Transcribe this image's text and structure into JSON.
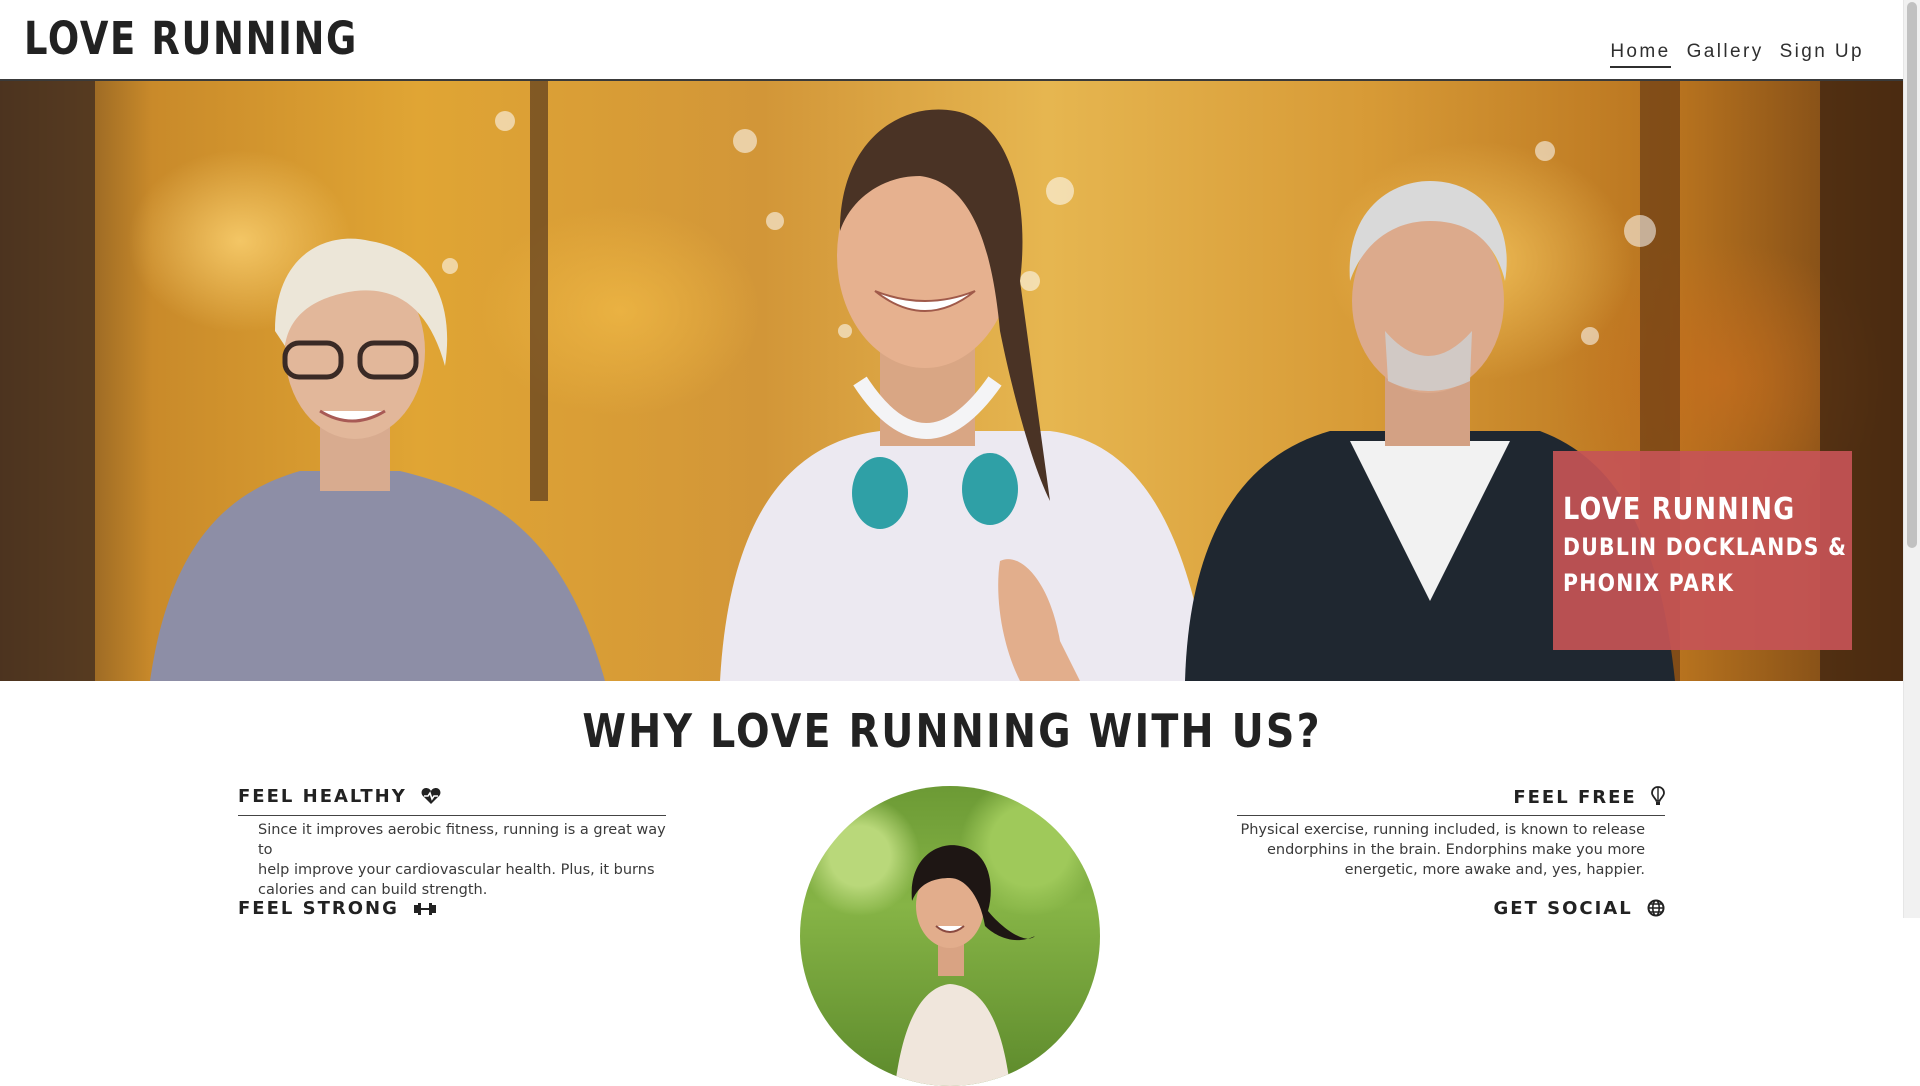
{
  "header": {
    "logo": "LOVE RUNNING",
    "nav": [
      {
        "label": "Home",
        "active": true
      },
      {
        "label": "Gallery",
        "active": false
      },
      {
        "label": "Sign Up",
        "active": false
      }
    ]
  },
  "hero": {
    "card_title": "LOVE RUNNING",
    "card_line1": "DUBLIN DOCKLANDS &",
    "card_line2": "PHONIX PARK",
    "card_color": "#c65456"
  },
  "main": {
    "title": "WHY LOVE RUNNING WITH US?",
    "features": [
      {
        "heading": "FEEL HEALTHY",
        "icon": "heartbeat-icon",
        "lines": [
          "Since it improves aerobic fitness, running is a great way to",
          "help improve your cardiovascular health. Plus, it burns",
          "calories and can build strength."
        ]
      },
      {
        "heading": "FEEL FREE",
        "icon": "hot-air-balloon-icon",
        "lines": [
          "Physical exercise, running included, is known to release",
          "endorphins in the brain. Endorphins make you more",
          "energetic, more awake and, yes, happier."
        ]
      },
      {
        "heading": "FEEL STRONG",
        "icon": "dumbbell-icon",
        "lines": []
      },
      {
        "heading": "GET SOCIAL",
        "icon": "globe-icon",
        "lines": []
      }
    ]
  }
}
